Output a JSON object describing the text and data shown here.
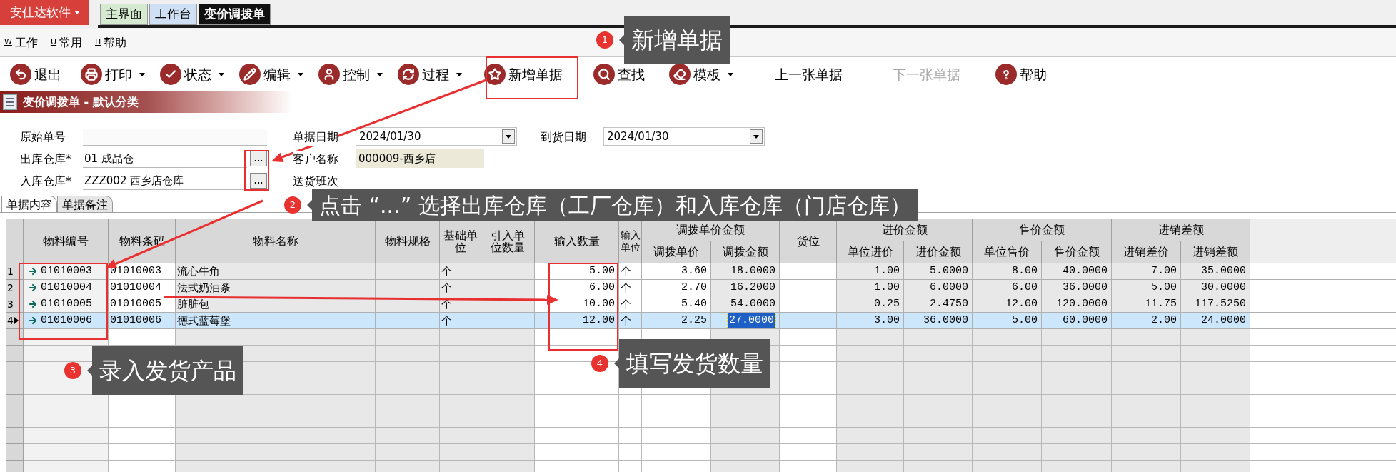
{
  "app_button": {
    "label": "安仕达软件"
  },
  "window_tabs": [
    {
      "label": "主界面",
      "selected": false,
      "color": "#d5ead0"
    },
    {
      "label": "工作台",
      "selected": false,
      "color": "#cfe0f5"
    },
    {
      "label": "变价调拨单",
      "selected": true,
      "color": "#111111"
    }
  ],
  "menu": [
    {
      "key": "W",
      "label": "工作"
    },
    {
      "key": "U",
      "label": "常用"
    },
    {
      "key": "H",
      "label": "帮助"
    }
  ],
  "toolbar": [
    {
      "label": "退出",
      "dropdown": false,
      "disabled": false
    },
    {
      "label": "打印",
      "dropdown": true,
      "disabled": false
    },
    {
      "label": "状态",
      "dropdown": true,
      "disabled": false
    },
    {
      "label": "编辑",
      "dropdown": true,
      "disabled": false
    },
    {
      "label": "控制",
      "dropdown": true,
      "disabled": false
    },
    {
      "label": "过程",
      "dropdown": true,
      "disabled": false
    },
    {
      "label": "新增单据",
      "dropdown": false,
      "disabled": false
    },
    {
      "label": "查找",
      "dropdown": false,
      "disabled": false
    },
    {
      "label": "模板",
      "dropdown": true,
      "disabled": false
    },
    {
      "label": "上一张单据",
      "dropdown": false,
      "disabled": false
    },
    {
      "label": "下一张单据",
      "dropdown": false,
      "disabled": true
    },
    {
      "label": "帮助",
      "dropdown": false,
      "disabled": false
    }
  ],
  "doc_title": "变价调拨单 - 默认分类",
  "form": {
    "left": [
      {
        "label": "原始单号",
        "kind": "line"
      },
      {
        "label": "出库仓库*",
        "value": "01 成品仓",
        "kind": "picker",
        "button": "..."
      },
      {
        "label": "入库仓库*",
        "value": "ZZZ002 西乡店仓库",
        "kind": "picker",
        "button": "..."
      }
    ],
    "middle": [
      {
        "label": "单据日期",
        "value": "2024/01/30",
        "kind": "date"
      },
      {
        "label": "客户名称",
        "value": "000009-西乡店",
        "kind": "readonly"
      },
      {
        "label": "送货班次",
        "kind": "label"
      }
    ],
    "right": [
      {
        "label": "到货日期",
        "value": "2024/01/30",
        "kind": "date"
      }
    ]
  },
  "sub_tabs": [
    {
      "label": "单据内容",
      "selected": true
    },
    {
      "label": "单据备注",
      "selected": false
    }
  ],
  "table": {
    "column_groups": [
      "调拨单价金额",
      "进价金额",
      "售价金额",
      "进销差额"
    ],
    "columns": [
      "物料编号",
      "物料条码",
      "物料名称",
      "物料规格",
      "基础单位",
      "引入单位数量",
      "输入数量",
      "输入单位",
      "调拨单价",
      "调拨金额",
      "货位",
      "单位进价",
      "进价金额",
      "单位售价",
      "售价金额",
      "进销差价",
      "进销差额"
    ],
    "rows": [
      {
        "no": "1",
        "selected": false,
        "cells": [
          "01010003",
          "01010003",
          "流心牛角",
          null,
          "个",
          null,
          "5.00",
          "个",
          "3.60",
          "18.0000",
          null,
          "1.00",
          "5.0000",
          "8.00",
          "40.0000",
          "7.00",
          "35.0000"
        ]
      },
      {
        "no": "2",
        "selected": false,
        "cells": [
          "01010004",
          "01010004",
          "法式奶油条",
          null,
          "个",
          null,
          "6.00",
          "个",
          "2.70",
          "16.2000",
          null,
          "1.00",
          "6.0000",
          "6.00",
          "36.0000",
          "5.00",
          "30.0000"
        ]
      },
      {
        "no": "3",
        "selected": false,
        "cells": [
          "01010005",
          "01010005",
          "脏脏包",
          null,
          "个",
          null,
          "10.00",
          "个",
          "5.40",
          "54.0000",
          null,
          "0.25",
          "2.4750",
          "12.00",
          "120.0000",
          "11.75",
          "117.5250"
        ]
      },
      {
        "no": "4",
        "selected": true,
        "cells": [
          "01010006",
          "01010006",
          "德式蓝莓堡",
          null,
          "个",
          null,
          "12.00",
          "个",
          "2.25",
          {
            "text": "27.0000",
            "focused": true
          },
          null,
          "3.00",
          "36.0000",
          "5.00",
          "60.0000",
          "2.00",
          "24.0000"
        ]
      }
    ]
  },
  "callouts": [
    {
      "number": "1",
      "text": "新增单据"
    },
    {
      "number": "2",
      "text": "点击 “...” 选择出库仓库（工厂仓库）和入库仓库（门店仓库）"
    },
    {
      "number": "3",
      "text": "录入发货产品"
    },
    {
      "number": "4",
      "text": "填写发货数量"
    }
  ]
}
